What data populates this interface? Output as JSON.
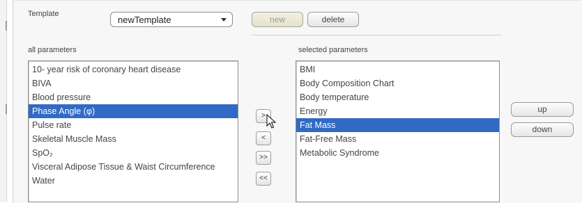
{
  "template": {
    "label": "Template",
    "selected": "newTemplate"
  },
  "buttons": {
    "new": "new",
    "delete": "delete",
    "move_right": ">",
    "move_left": "<",
    "move_all_right": ">>",
    "move_all_left": "<<",
    "up": "up",
    "down": "down"
  },
  "all_parameters": {
    "label": "all parameters",
    "items": [
      "10- year risk of coronary heart disease",
      "BIVA",
      "Blood pressure",
      "Phase Angle (φ)",
      "Pulse rate",
      "Skeletal Muscle Mass",
      "SpO₂",
      "Visceral Adipose Tissue & Waist Circumference",
      "Water"
    ],
    "selected_index": 3
  },
  "selected_parameters": {
    "label": "selected parameters",
    "items": [
      "BMI",
      "Body Composition Chart",
      "Body temperature",
      "Energy",
      "Fat Mass",
      "Fat-Free Mass",
      "Metabolic Syndrome"
    ],
    "selected_index": 4
  },
  "colors": {
    "selection": "#316ac5",
    "panel": "#f7f7f7"
  },
  "icons": {
    "cursor": "mouse-cursor-icon",
    "dropdown": "chevron-down-icon"
  }
}
